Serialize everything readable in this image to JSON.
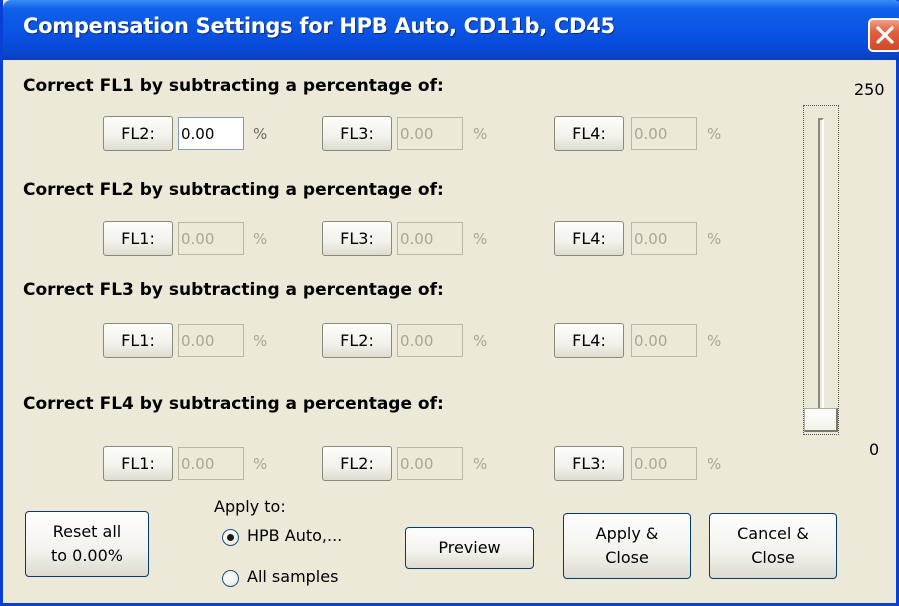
{
  "window": {
    "title": "Compensation Settings for HPB Auto, CD11b, CD45",
    "close_glyph": "close-icon"
  },
  "sections": [
    {
      "heading": "Correct FL1 by subtracting a percentage of:",
      "fields": [
        {
          "label": "FL2:",
          "value": "0.00",
          "unit": "%",
          "enabled": true
        },
        {
          "label": "FL3:",
          "value": "0.00",
          "unit": "%",
          "enabled": false
        },
        {
          "label": "FL4:",
          "value": "0.00",
          "unit": "%",
          "enabled": false
        }
      ]
    },
    {
      "heading": "Correct FL2 by subtracting a percentage of:",
      "fields": [
        {
          "label": "FL1:",
          "value": "0.00",
          "unit": "%",
          "enabled": false
        },
        {
          "label": "FL3:",
          "value": "0.00",
          "unit": "%",
          "enabled": false
        },
        {
          "label": "FL4:",
          "value": "0.00",
          "unit": "%",
          "enabled": false
        }
      ]
    },
    {
      "heading": "Correct FL3 by subtracting a percentage of:",
      "fields": [
        {
          "label": "FL1:",
          "value": "0.00",
          "unit": "%",
          "enabled": false
        },
        {
          "label": "FL2:",
          "value": "0.00",
          "unit": "%",
          "enabled": false
        },
        {
          "label": "FL4:",
          "value": "0.00",
          "unit": "%",
          "enabled": false
        }
      ]
    },
    {
      "heading": "Correct FL4 by subtracting a percentage of:",
      "fields": [
        {
          "label": "FL1:",
          "value": "0.00",
          "unit": "%",
          "enabled": false
        },
        {
          "label": "FL2:",
          "value": "0.00",
          "unit": "%",
          "enabled": false
        },
        {
          "label": "FL3:",
          "value": "0.00",
          "unit": "%",
          "enabled": false
        }
      ]
    }
  ],
  "slider": {
    "max_label": "250",
    "min_label": "0",
    "level": 0
  },
  "footer": {
    "reset_label_line1": "Reset all",
    "reset_label_line2": "to 0.00%",
    "apply_to_label": "Apply to:",
    "radio_current": "HPB Auto,...",
    "radio_all": "All samples",
    "preview_label": "Preview",
    "apply_close_line1": "Apply &",
    "apply_close_line2": "Close",
    "cancel_close_line1": "Cancel &",
    "cancel_close_line2": "Close"
  },
  "colors": {
    "titlebar": "#0a54e4",
    "dialog_bg": "#ece9d8",
    "close_button": "#e0603e"
  }
}
